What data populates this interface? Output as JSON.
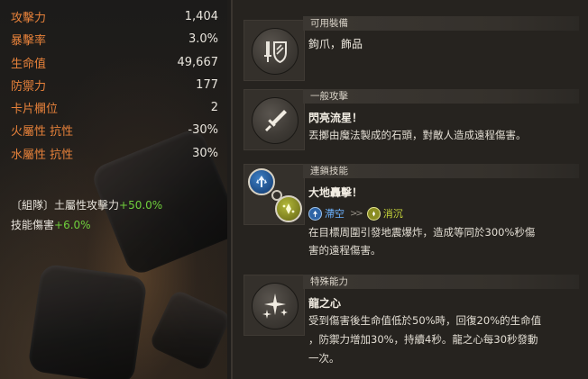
{
  "stats": [
    {
      "label": "攻擊力",
      "value": "1,404"
    },
    {
      "label": "暴擊率",
      "value": "3.0%"
    },
    {
      "label": "生命值",
      "value": "49,667"
    },
    {
      "label": "防禦力",
      "value": "177"
    },
    {
      "label": "卡片欄位",
      "value": "2"
    },
    {
      "label": "火屬性 抗性",
      "value": "-30%"
    },
    {
      "label": "水屬性 抗性",
      "value": "30%"
    }
  ],
  "bonuses": {
    "line1_text": "〔組隊〕土屬性攻擊力",
    "line1_value": "+50.0%",
    "line2_text": "技能傷害",
    "line2_value": "+6.0%"
  },
  "equip": {
    "header": "可用裝備",
    "text": "鉤爪，飾品",
    "icon": "sword-shield-icon"
  },
  "basic_attack": {
    "header": "一般攻擊",
    "title": "閃亮流星！",
    "desc": "丟擲由魔法製成的石頭，對敵人造成遠程傷害。",
    "icon": "dagger-icon"
  },
  "chain_skill": {
    "header": "連鎖技能",
    "title": "大地轟擊！",
    "from_state": "滯空",
    "to_state": "消沉",
    "arrows": ">>",
    "desc_line1": "在目標周圍引發地震爆炸，造成等同於300%秒傷",
    "desc_line2": "害的遠程傷害。",
    "icons": [
      "airborne-icon",
      "downed-icon"
    ],
    "colors": {
      "from": "#6cb2ff",
      "to": "#c9d73a"
    }
  },
  "special": {
    "header": "特殊能力",
    "title": "龍之心",
    "desc_line1": "受到傷害後生命值低於50%時，回復20%的生命值",
    "desc_line2": "，防禦力增加30%，持續4秒。龍之心每30秒發動",
    "desc_line3": "一次。",
    "icon": "sparkle-icon"
  },
  "colors": {
    "stat_label": "#e6813a",
    "bonus_positive": "#6fcf3c"
  }
}
